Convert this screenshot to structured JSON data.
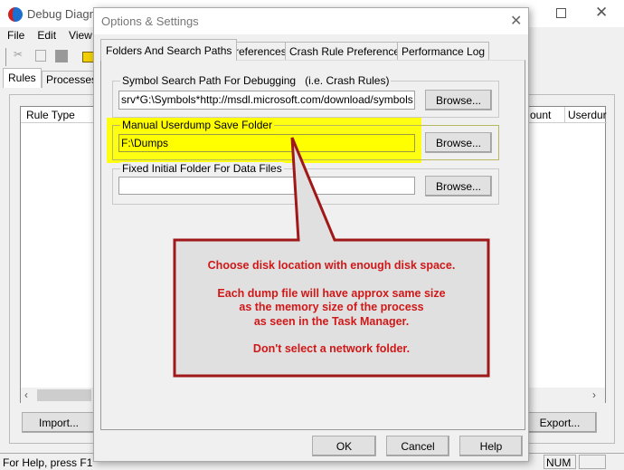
{
  "main_window": {
    "title": "Debug Diagno",
    "menu": [
      "File",
      "Edit",
      "View"
    ],
    "tabs": [
      "Rules",
      "Processes"
    ],
    "columns": [
      "Rule Type",
      "ount",
      "Userdur"
    ],
    "import_label": "Import...",
    "export_label": "Export...",
    "status_text": "For Help, press F1",
    "num_indicator": "NUM"
  },
  "dialog": {
    "title": "Options & Settings",
    "tabs": [
      "Folders And Search Paths",
      "Preferences",
      "Crash Rule Preferences",
      "Performance Log"
    ],
    "groups": [
      {
        "label": "Symbol Search Path For Debugging   (i.e. Crash Rules)",
        "value": "srv*G:\\Symbols*http://msdl.microsoft.com/download/symbols",
        "browse": "Browse..."
      },
      {
        "label": "Manual Userdump Save Folder",
        "value": "F:\\Dumps",
        "browse": "Browse..."
      },
      {
        "label": "Fixed Initial Folder For Data Files",
        "value": "",
        "browse": "Browse..."
      }
    ],
    "ok": "OK",
    "cancel": "Cancel",
    "help": "Help"
  },
  "callout": {
    "lines": [
      "Choose disk location with enough disk space.",
      "",
      "Each dump file will have approx same size",
      "as the memory size of the process",
      "as seen in the Task Manager.",
      "",
      "Don't select a network folder."
    ],
    "text_color": "#d01818",
    "border_color": "#a01818",
    "highlight_color": "#ffff00"
  }
}
